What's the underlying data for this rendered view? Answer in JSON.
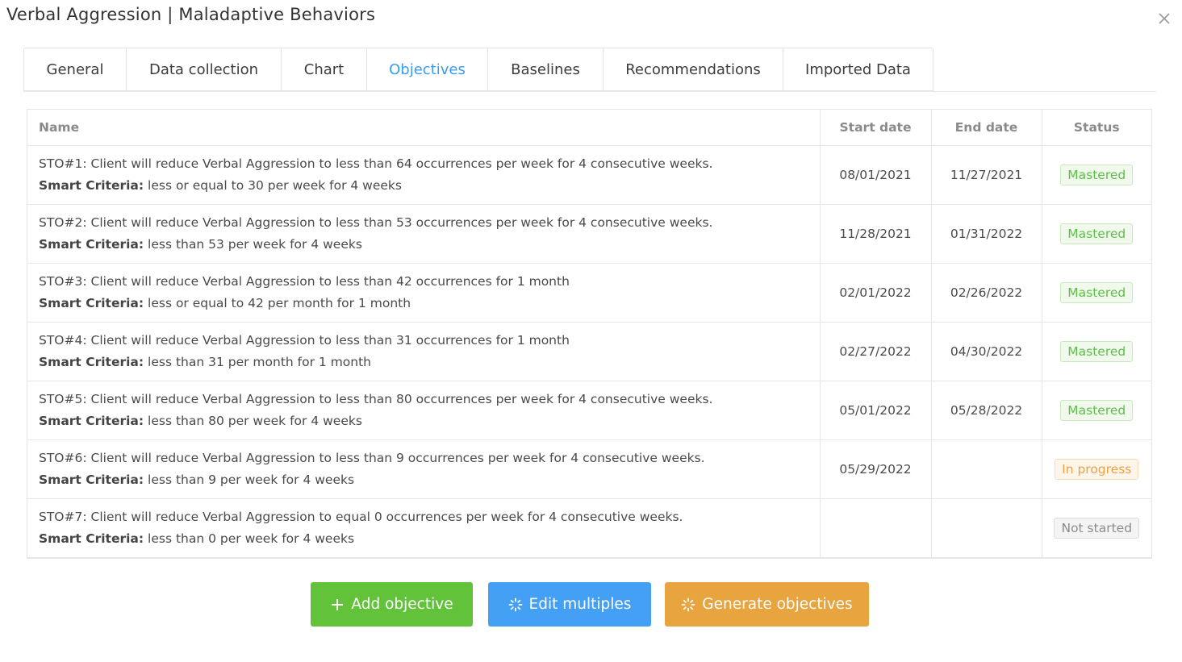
{
  "dialog": {
    "title": "Verbal Aggression | Maladaptive Behaviors",
    "close_icon": "close-icon"
  },
  "tabs": [
    {
      "label": "General",
      "active": false
    },
    {
      "label": "Data collection",
      "active": false
    },
    {
      "label": "Chart",
      "active": false
    },
    {
      "label": "Objectives",
      "active": true
    },
    {
      "label": "Baselines",
      "active": false
    },
    {
      "label": "Recommendations",
      "active": false
    },
    {
      "label": "Imported Data",
      "active": false
    }
  ],
  "table": {
    "headers": {
      "name": "Name",
      "start": "Start date",
      "end": "End date",
      "status": "Status"
    },
    "criteria_label": "Smart Criteria:",
    "rows": [
      {
        "name": "STO#1: Client will reduce Verbal Aggression to less than 64 occurrences per week for 4 consecutive weeks.",
        "criteria": "less or equal to 30 per week for 4 weeks",
        "start": "08/01/2021",
        "end": "11/27/2021",
        "status": "Mastered"
      },
      {
        "name": "STO#2: Client will reduce Verbal Aggression to less than 53 occurrences per week for 4 consecutive weeks.",
        "criteria": "less than 53 per week for 4 weeks",
        "start": "11/28/2021",
        "end": "01/31/2022",
        "status": "Mastered"
      },
      {
        "name": "STO#3: Client will reduce Verbal Aggression to less than 42 occurrences for 1 month",
        "criteria": "less or equal to 42 per month for 1 month",
        "start": "02/01/2022",
        "end": "02/26/2022",
        "status": "Mastered"
      },
      {
        "name": "STO#4: Client will reduce Verbal Aggression to less than 31 occurrences for 1 month",
        "criteria": "less than 31 per month for 1 month",
        "start": "02/27/2022",
        "end": "04/30/2022",
        "status": "Mastered"
      },
      {
        "name": "STO#5: Client will reduce Verbal Aggression to less than 80 occurrences per week for 4 consecutive weeks.",
        "criteria": "less than 80 per week for 4 weeks",
        "start": "05/01/2022",
        "end": "05/28/2022",
        "status": "Mastered"
      },
      {
        "name": "STO#6: Client will reduce Verbal Aggression to less than 9 occurrences per week for 4 consecutive weeks.",
        "criteria": "less than 9 per week for 4 weeks",
        "start": "05/29/2022",
        "end": "",
        "status": "In progress"
      },
      {
        "name": "STO#7: Client will reduce Verbal Aggression to equal 0 occurrences per week for 4 consecutive weeks.",
        "criteria": "less than 0 per week for 4 weeks",
        "start": "",
        "end": "",
        "status": "Not started"
      }
    ]
  },
  "buttons": {
    "add": {
      "label": "Add objective",
      "icon": "plus-icon"
    },
    "edit": {
      "label": "Edit multiples",
      "icon": "sparkle-icon"
    },
    "generate": {
      "label": "Generate objectives",
      "icon": "sparkle-icon"
    }
  },
  "colors": {
    "accent": "#3a9cf0",
    "add_button": "#62c33b",
    "edit_button": "#44a0f5",
    "generate_button": "#e8a43f",
    "mastered": "#5cbf48",
    "in_progress": "#e9a24a",
    "not_started": "#8c8c8c"
  }
}
